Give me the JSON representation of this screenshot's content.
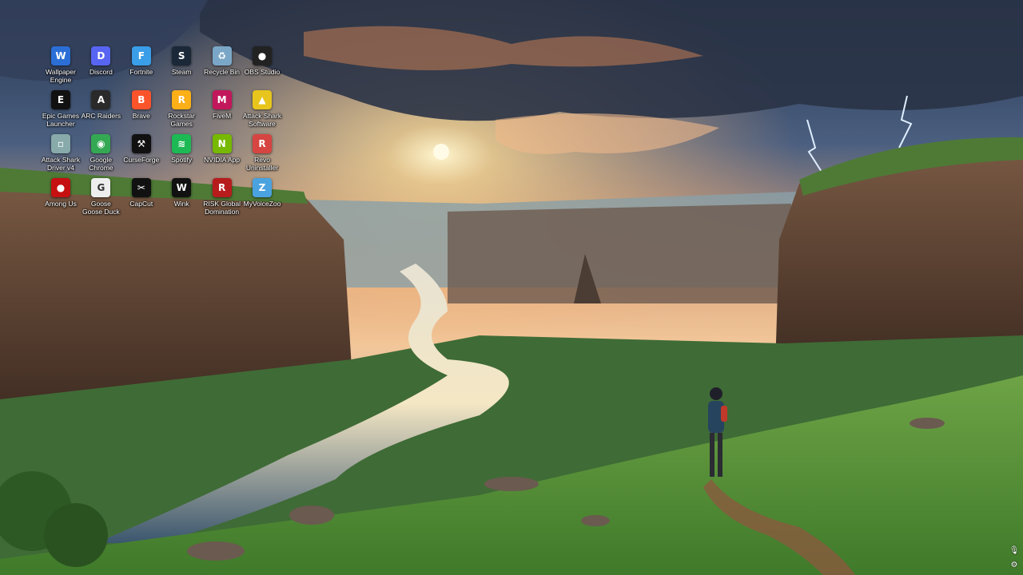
{
  "desktop": {
    "icons": [
      {
        "label": "Wallpaper Engine",
        "icon": "wallpaper-engine-icon",
        "glyph": "W",
        "color": "#2b6fd6"
      },
      {
        "label": "Discord",
        "icon": "discord-icon",
        "glyph": "D",
        "color": "#5865f2"
      },
      {
        "label": "Fortnite",
        "icon": "fortnite-icon",
        "glyph": "F",
        "color": "#3a9ee8"
      },
      {
        "label": "Steam",
        "icon": "steam-icon",
        "glyph": "S",
        "color": "#1b2838"
      },
      {
        "label": "Recycle Bin",
        "icon": "recycle-bin-icon",
        "glyph": "♻",
        "color": "#7aa7c7"
      },
      {
        "label": "OBS Studio",
        "icon": "obs-studio-icon",
        "glyph": "●",
        "color": "#222"
      },
      {
        "label": "Epic Games Launcher",
        "icon": "epic-games-icon",
        "glyph": "E",
        "color": "#111"
      },
      {
        "label": "ARC Raiders",
        "icon": "arc-raiders-icon",
        "glyph": "A",
        "color": "#2a2a2a"
      },
      {
        "label": "Brave",
        "icon": "brave-icon",
        "glyph": "B",
        "color": "#fb542b"
      },
      {
        "label": "Rockstar Games",
        "icon": "rockstar-icon",
        "glyph": "R",
        "color": "#fcaf17"
      },
      {
        "label": "FiveM",
        "icon": "fivem-icon",
        "glyph": "M",
        "color": "#c2185b"
      },
      {
        "label": "Attack Shark Software",
        "icon": "attack-shark-icon",
        "glyph": "▲",
        "color": "#e8c51c"
      },
      {
        "label": "Attack Shark Driver v4",
        "icon": "attack-shark-driver-icon",
        "glyph": "▫",
        "color": "#8aa"
      },
      {
        "label": "Google Chrome",
        "icon": "chrome-icon",
        "glyph": "◉",
        "color": "#34a853"
      },
      {
        "label": "CurseForge",
        "icon": "curseforge-icon",
        "glyph": "⚒",
        "color": "#111"
      },
      {
        "label": "Spotify",
        "icon": "spotify-icon",
        "glyph": "≋",
        "color": "#1db954"
      },
      {
        "label": "NVIDIA App",
        "icon": "nvidia-icon",
        "glyph": "N",
        "color": "#76b900"
      },
      {
        "label": "Revo Uninstaller",
        "icon": "revo-uninstaller-icon",
        "glyph": "R",
        "color": "#d64541"
      },
      {
        "label": "Among Us",
        "icon": "among-us-icon",
        "glyph": "●",
        "color": "#c51111"
      },
      {
        "label": "Goose Goose Duck",
        "icon": "goose-goose-duck-icon",
        "glyph": "G",
        "color": "#eee"
      },
      {
        "label": "CapCut",
        "icon": "capcut-icon",
        "glyph": "✂",
        "color": "#111"
      },
      {
        "label": "Wink",
        "icon": "wink-icon",
        "glyph": "W",
        "color": "#111"
      },
      {
        "label": "RISK Global Domination",
        "icon": "risk-icon",
        "glyph": "R",
        "color": "#b71c1c"
      },
      {
        "label": "MyVoiceZoo",
        "icon": "myvoicezoo-icon",
        "glyph": "Z",
        "color": "#4aa3df"
      }
    ]
  },
  "tray": {
    "mic_icon": "microphone-icon",
    "settings_icon": "settings-icon"
  },
  "colors": {
    "sky_top": "#2b3e5c",
    "sun": "#ffe6a8",
    "grass": "#5f9a3a",
    "river": "#c9d8e6"
  }
}
